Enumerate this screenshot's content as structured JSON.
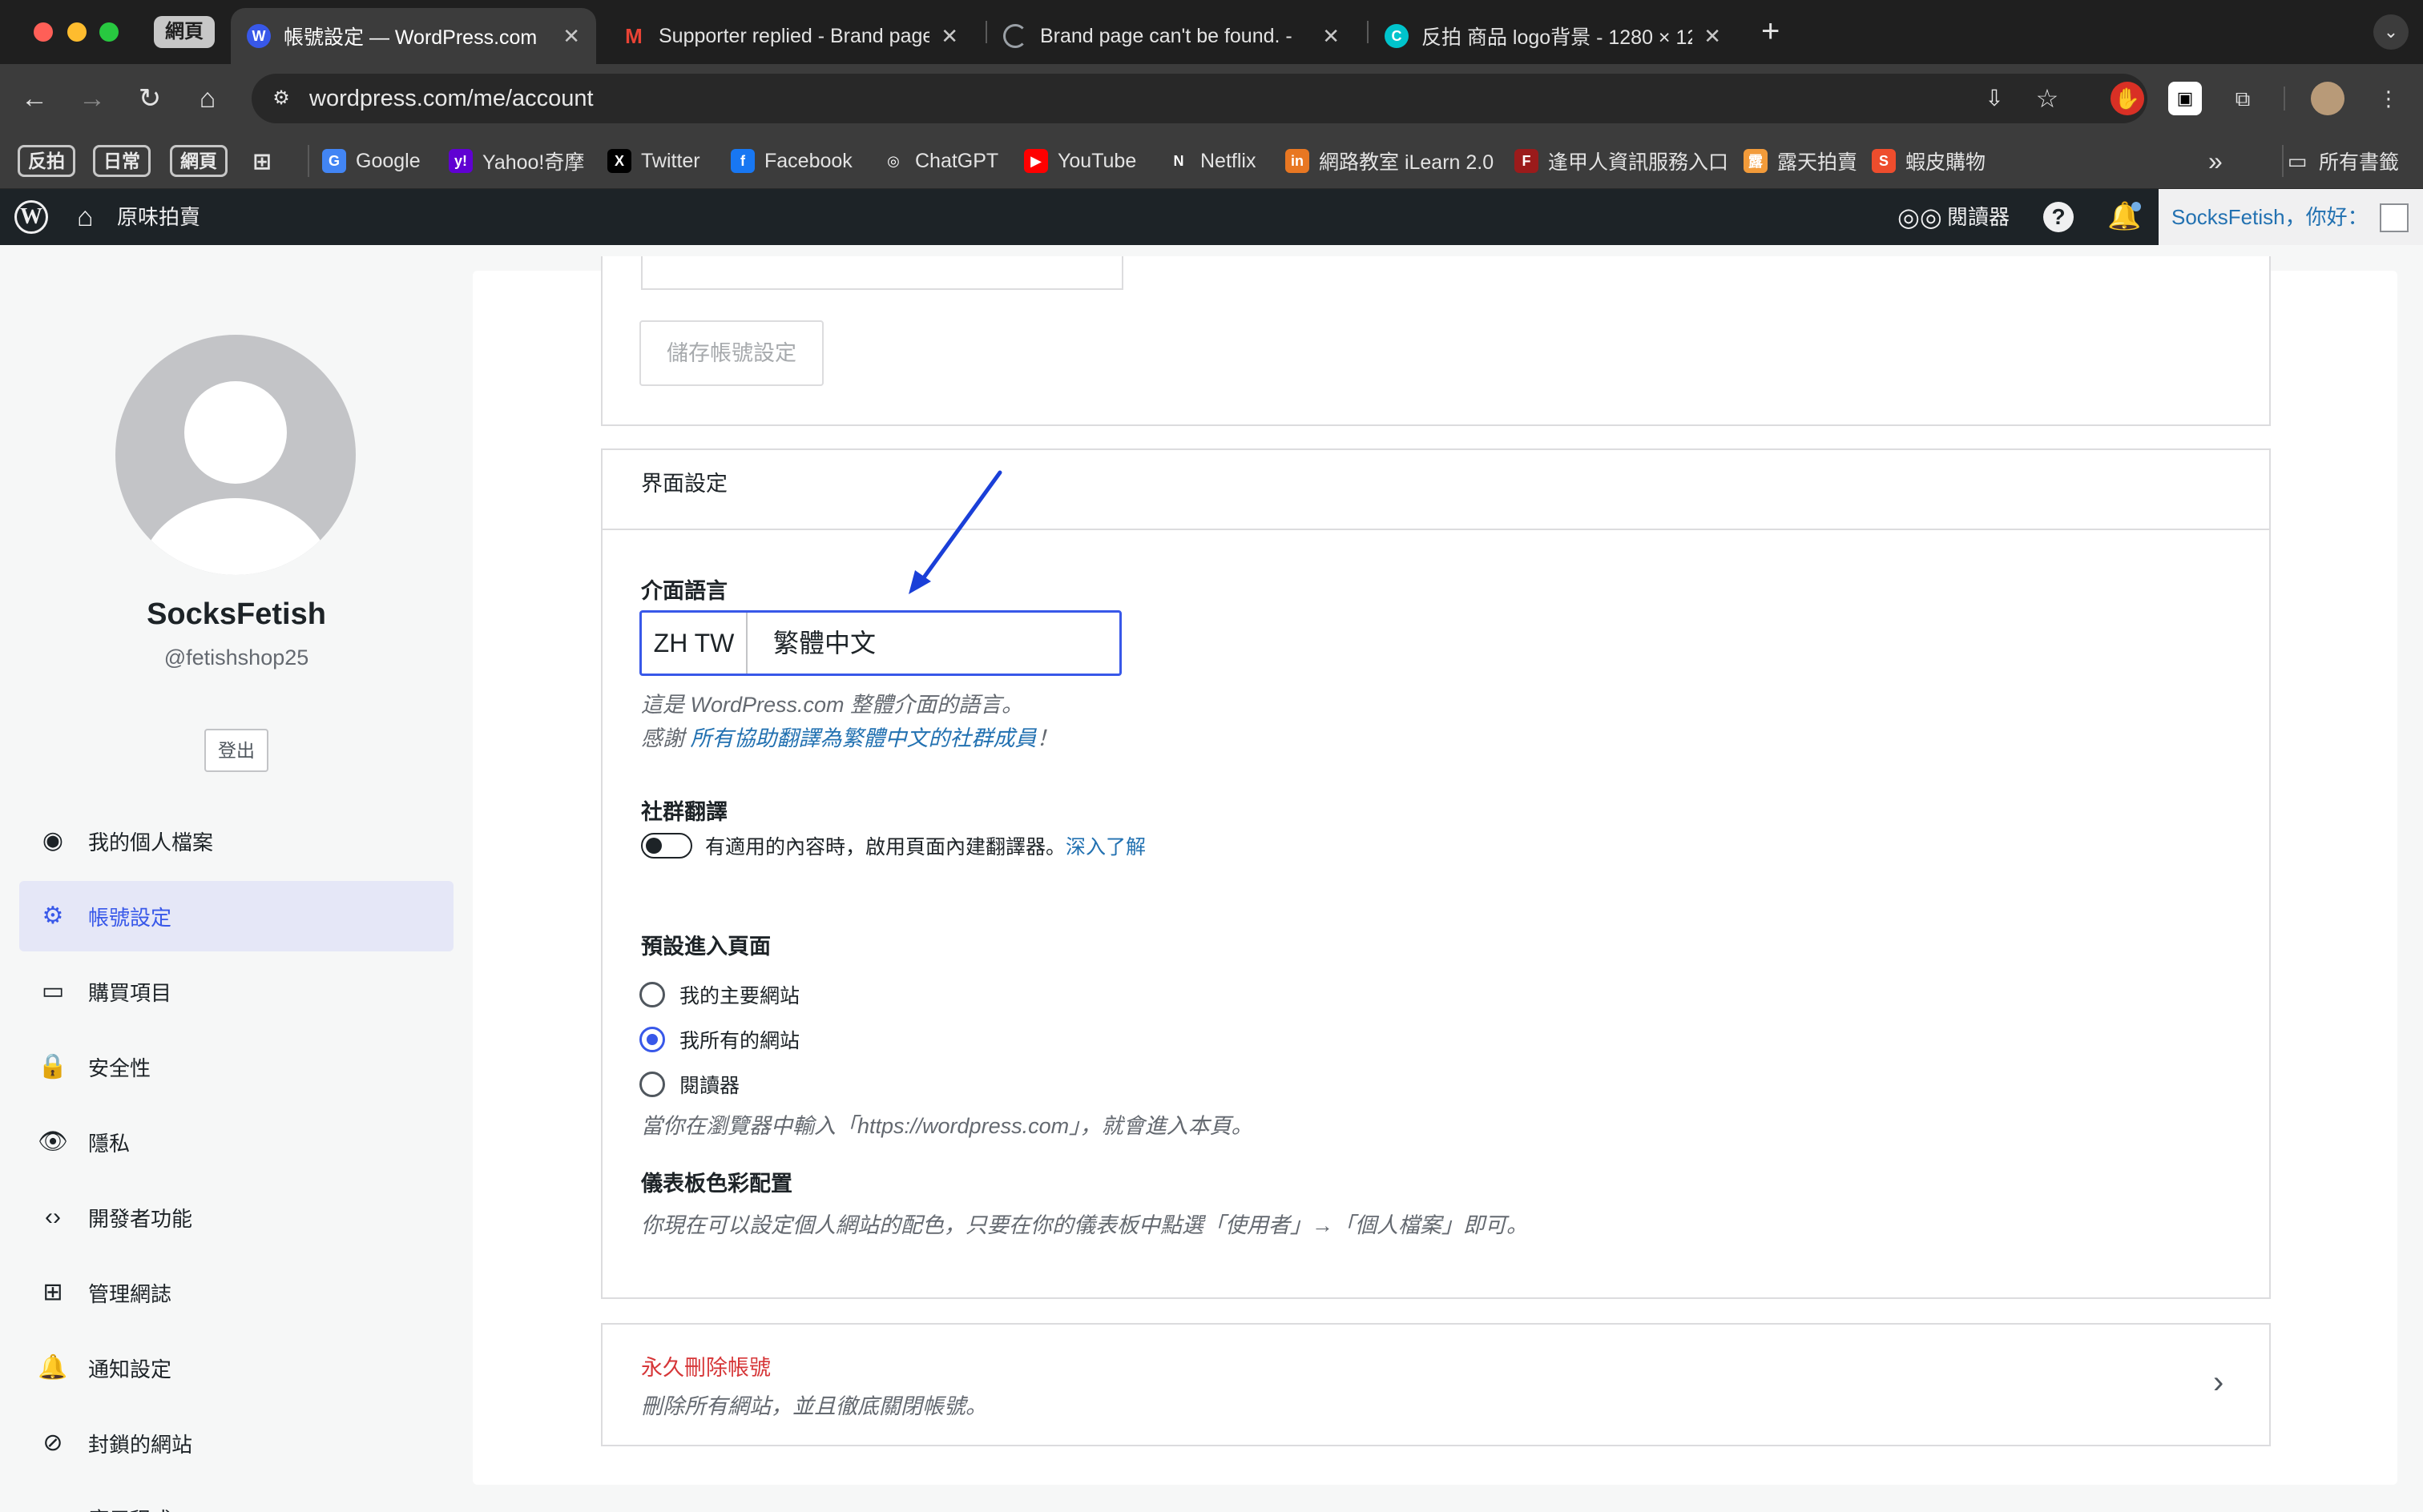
{
  "browser": {
    "tab_group": "網頁",
    "tabs": [
      {
        "title": "帳號設定 — WordPress.com",
        "icon": "wordpress-icon",
        "active": true
      },
      {
        "title": "Supporter replied - Brand page",
        "icon": "gmail-icon"
      },
      {
        "title": "Brand page can't be found. -",
        "icon": "loading-icon"
      },
      {
        "title": "反拍 商品 logo背景 - 1280 × 12",
        "icon": "canva-icon"
      }
    ],
    "new_tab": "+",
    "url": "wordpress.com/me/account",
    "bookmark_groups": [
      "反拍",
      "日常",
      "網頁"
    ],
    "bookmarks": [
      {
        "label": "Google",
        "color": "#4285f4",
        "glyph": "G"
      },
      {
        "label": "Yahoo!奇摩",
        "color": "#6001d2",
        "glyph": "y!"
      },
      {
        "label": "Twitter",
        "color": "#000000",
        "glyph": "X"
      },
      {
        "label": "Facebook",
        "color": "#1877f2",
        "glyph": "f"
      },
      {
        "label": "ChatGPT",
        "color": "#3c3c3c",
        "glyph": "◎"
      },
      {
        "label": "YouTube",
        "color": "#ff0000",
        "glyph": "▶"
      },
      {
        "label": "Netflix",
        "color": "#3c3c3c",
        "glyph": "N"
      },
      {
        "label": "網路教室 iLearn 2.0",
        "color": "#e87722",
        "glyph": "in"
      },
      {
        "label": "逢甲人資訊服務入口",
        "color": "#9b1b1b",
        "glyph": "F"
      },
      {
        "label": "露天拍賣",
        "color": "#f29b3a",
        "glyph": "露"
      },
      {
        "label": "蝦皮購物",
        "color": "#ee4d2d",
        "glyph": "S"
      }
    ],
    "overflow": "»",
    "all_bookmarks": "所有書籤"
  },
  "wpbar": {
    "site_name": "原味拍賣",
    "reader": "閱讀器",
    "greeting": "SocksFetish，你好："
  },
  "profile": {
    "name": "SocksFetish",
    "handle": "@fetishshop25",
    "logout": "登出"
  },
  "sidebar": {
    "items": [
      {
        "label": "我的個人檔案",
        "icon": "profile-icon",
        "glyph": "◉"
      },
      {
        "label": "帳號設定",
        "icon": "gear-icon",
        "glyph": "⚙",
        "active": true
      },
      {
        "label": "購買項目",
        "icon": "credit-card-icon",
        "glyph": "▭"
      },
      {
        "label": "安全性",
        "icon": "lock-icon",
        "glyph": "🔒"
      },
      {
        "label": "隱私",
        "icon": "eye-icon",
        "glyph": "👁"
      },
      {
        "label": "開發者功能",
        "icon": "code-icon",
        "glyph": "‹›"
      },
      {
        "label": "管理網誌",
        "icon": "grid-icon",
        "glyph": "⊞"
      },
      {
        "label": "通知設定",
        "icon": "bell-icon",
        "glyph": "🔔"
      },
      {
        "label": "封鎖的網站",
        "icon": "block-icon",
        "glyph": "⊘"
      },
      {
        "label": "應用程式",
        "icon": "apps-icon",
        "glyph": "●"
      }
    ]
  },
  "account": {
    "save_button": "儲存帳號設定"
  },
  "interface": {
    "section_title": "界面設定",
    "language_label": "介面語言",
    "language_code": "ZH TW",
    "language_name": "繁體中文",
    "language_hint": "這是 WordPress.com 整體介面的語言。",
    "thanks_prefix": "感謝 ",
    "thanks_link": "所有協助翻譯為繁體中文的社群成員",
    "thanks_suffix": "！",
    "community_label": "社群翻譯",
    "community_text": "有適用的內容時，啟用頁面內建翻譯器。",
    "community_link": "深入了解",
    "community_enabled": false,
    "landing_label": "預設進入頁面",
    "landing_options": [
      "我的主要網站",
      "我所有的網站",
      "閱讀器"
    ],
    "landing_selected": 1,
    "landing_hint": "當你在瀏覽器中輸入「https://wordpress.com」，就會進入本頁。",
    "color_label": "儀表板色彩配置",
    "color_hint": "你現在可以設定個人網站的配色，只要在你的儀表板中點選「使用者」→「個人檔案」即可。"
  },
  "delete": {
    "title": "永久刪除帳號",
    "subtitle": "刪除所有網站，並且徹底關閉帳號。"
  },
  "annotation": {
    "arrow_color": "#1a3fd8"
  }
}
